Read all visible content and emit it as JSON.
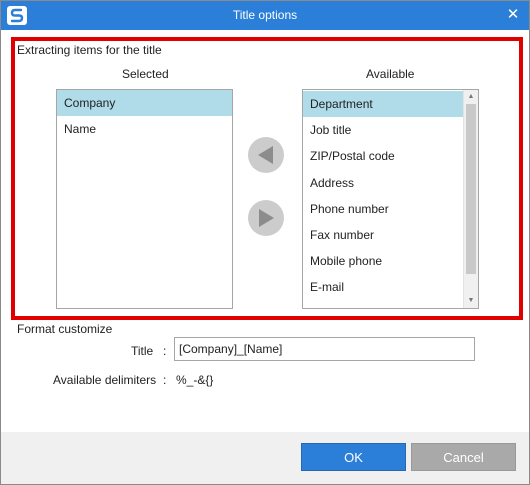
{
  "window": {
    "title": "Title options",
    "close_glyph": "✕"
  },
  "extract": {
    "heading": "Extracting items for the title",
    "selected_label": "Selected",
    "available_label": "Available",
    "selected_items": [
      "Company",
      "Name"
    ],
    "available_items": [
      "Department",
      "Job title",
      "ZIP/Postal code",
      "Address",
      "Phone number",
      "Fax number",
      "Mobile phone",
      "E-mail"
    ],
    "move_left_icon": "triangle-left-icon",
    "move_right_icon": "triangle-right-icon"
  },
  "format": {
    "heading": "Format customize",
    "title_label": "Title",
    "title_colon": ":",
    "title_value": "[Company]_[Name]",
    "delimiters_label": "Available delimiters",
    "delimiters_colon": ":",
    "delimiters_value": "%_-&{}"
  },
  "buttons": {
    "ok": "OK",
    "cancel": "Cancel"
  },
  "colors": {
    "titlebar": "#2b7fd8",
    "highlight_border": "#e00000",
    "selected_row": "#b0dbe9",
    "ok_button": "#2b7fd8",
    "cancel_button": "#a9a9a9"
  }
}
